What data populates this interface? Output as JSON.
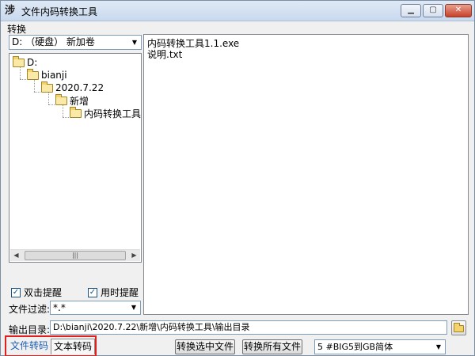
{
  "window": {
    "title": "文件内码转换工具",
    "app_icon_glyph": "涉",
    "minimize_glyph": "▁",
    "maximize_glyph": "▢",
    "close_glyph": "✕"
  },
  "menu": {
    "items": [
      {
        "label": "转换"
      }
    ]
  },
  "drive": {
    "selected": "D: （硬盘） 新加卷",
    "arrow": "▼"
  },
  "tree": {
    "nodes": [
      {
        "label": "D:",
        "level": 0
      },
      {
        "label": "bianji",
        "level": 1
      },
      {
        "label": "2020.7.22",
        "level": 2
      },
      {
        "label": "新增",
        "level": 3
      },
      {
        "label": "内码转换工具",
        "level": 4
      }
    ],
    "scroll_left": "◀",
    "scroll_right": "▶",
    "scroll_thumb": "|||"
  },
  "options": {
    "double_click_label": "双击提醒",
    "double_click_checked": true,
    "timing_label": "用时提醒",
    "timing_checked": true,
    "check_glyph": "✓"
  },
  "filter": {
    "label": "文件过滤:",
    "value": "*.*",
    "arrow": "▼"
  },
  "files": [
    "内码转换工具1.1.exe",
    "说明.txt"
  ],
  "output": {
    "label": "输出目录:",
    "path": "D:\\bianji\\2020.7.22\\新增\\内码转换工具\\输出目录"
  },
  "tabs": [
    {
      "label": "文件转码",
      "active": true
    },
    {
      "label": "文本转码",
      "active": false
    }
  ],
  "actions": {
    "convert_selected": "转换选中文件",
    "convert_all": "转换所有文件"
  },
  "mode": {
    "selected": "5 #BIG5到GB简体",
    "arrow": "▼"
  },
  "colors": {
    "highlight_border": "#e0201e",
    "active_tab_text": "#1f5fb5",
    "folder_fill": "#f4d36b"
  }
}
